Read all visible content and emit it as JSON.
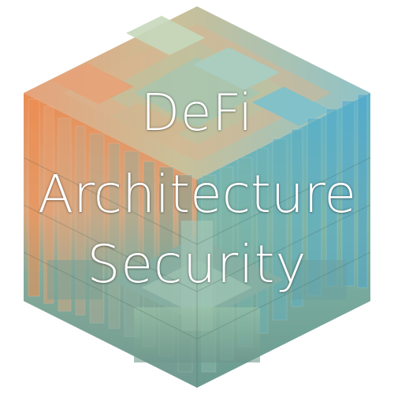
{
  "title": {
    "line1": "DeFi",
    "line2": "Architecture",
    "line3": "Security"
  },
  "palette": {
    "orange": "#e8955a",
    "peach": "#e9b08a",
    "sage": "#8fb39a",
    "teal": "#4aa7c0",
    "slate": "#6f8f8a",
    "text": "#ffffff"
  }
}
